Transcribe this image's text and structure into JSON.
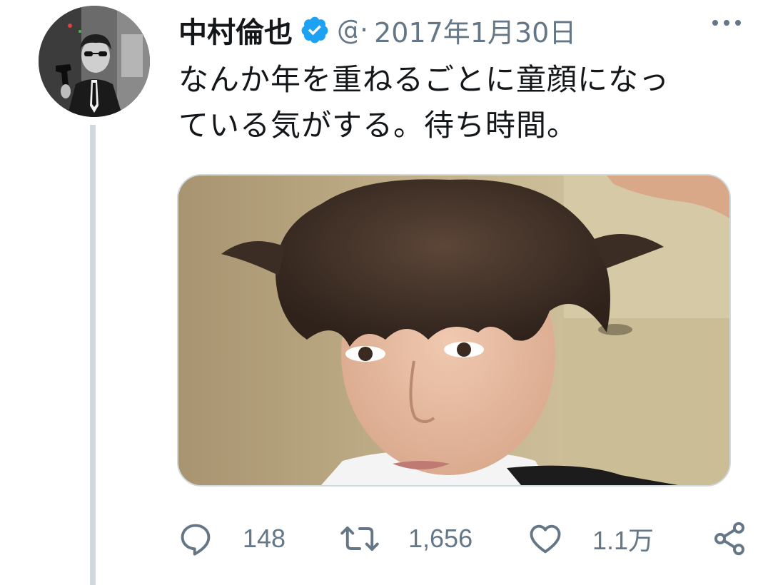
{
  "user": {
    "display_name": "中村倫也",
    "handle": "@",
    "verified": true
  },
  "separator": "·",
  "date": "2017年1月30日",
  "tweet": {
    "text_line1": "なんか年を重ねるごとに童顔になっ",
    "text_line2": "ている気がする。待ち時間。"
  },
  "stats": {
    "replies": "148",
    "retweets": "1,656",
    "likes": "1.1万"
  },
  "icons": {
    "more": "more-horizontal-icon",
    "verified": "verified-badge-icon",
    "reply": "reply-icon",
    "retweet": "retweet-icon",
    "like": "heart-icon",
    "share": "share-icon"
  },
  "colors": {
    "text": "#14171a",
    "secondary": "#657786",
    "verified": "#1da1f2",
    "thread_line": "#cfd9de"
  }
}
